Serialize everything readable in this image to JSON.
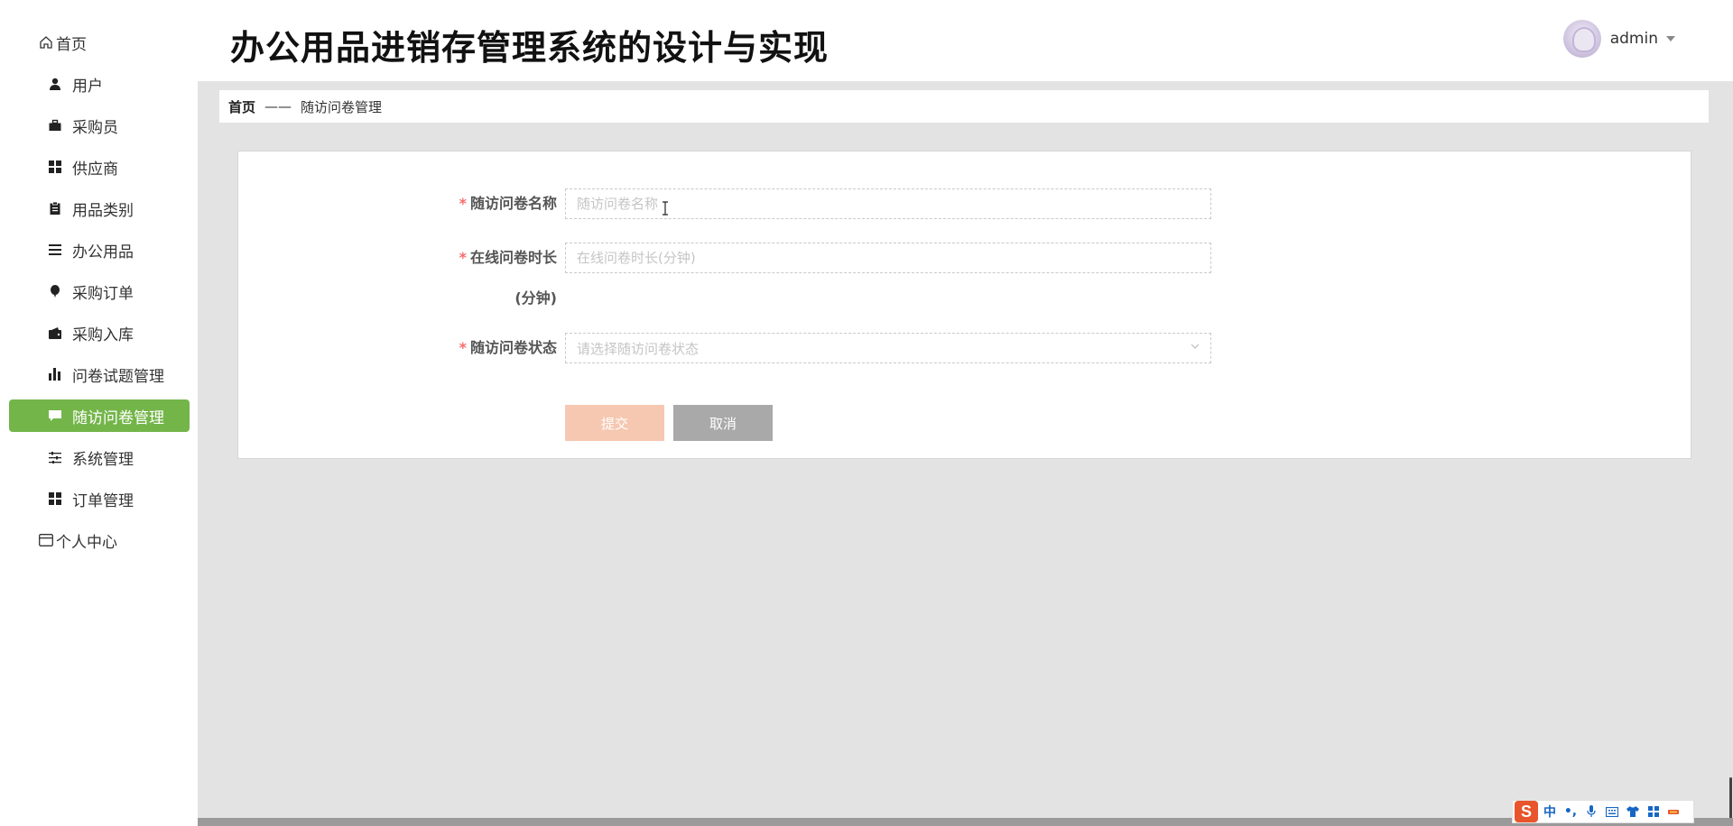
{
  "app": {
    "title": "办公用品进销存管理系统的设计与实现"
  },
  "user": {
    "name": "admin"
  },
  "sidebar": {
    "items": [
      {
        "label": "首页",
        "icon": "home-icon"
      },
      {
        "label": "用户",
        "icon": "user-icon"
      },
      {
        "label": "采购员",
        "icon": "briefcase-icon"
      },
      {
        "label": "供应商",
        "icon": "grid-icon"
      },
      {
        "label": "用品类别",
        "icon": "clipboard-icon"
      },
      {
        "label": "办公用品",
        "icon": "list-icon"
      },
      {
        "label": "采购订单",
        "icon": "balloon-icon"
      },
      {
        "label": "采购入库",
        "icon": "wallet-icon"
      },
      {
        "label": "问卷试题管理",
        "icon": "bar-chart-icon"
      },
      {
        "label": "随访问卷管理",
        "icon": "chat-icon",
        "active": true
      },
      {
        "label": "系统管理",
        "icon": "sliders-icon"
      },
      {
        "label": "订单管理",
        "icon": "grid-icon"
      },
      {
        "label": "个人中心",
        "icon": "card-icon"
      }
    ]
  },
  "breadcrumb": {
    "home": "首页",
    "separator": "——",
    "current": "随访问卷管理"
  },
  "form": {
    "name_label": "随访问卷名称",
    "name_placeholder": "随访问卷名称",
    "duration_label": "在线问卷时长",
    "duration_label_2": "(分钟)",
    "duration_placeholder": "在线问卷时长(分钟)",
    "status_label": "随访问卷状态",
    "status_placeholder": "请选择随访问卷状态",
    "required_mark": "*",
    "submit_label": "提交",
    "cancel_label": "取消"
  },
  "ime": {
    "logo": "S",
    "mode": "中",
    "punct": "•,",
    "icons": [
      "microphone-icon",
      "keyboard-icon",
      "shirt-icon",
      "apps-icon",
      "tools-icon"
    ]
  },
  "colors": {
    "active_menu": "#74b54a",
    "submit_button": "#f6c8b1",
    "cancel_button": "#a9a9a9",
    "required": "#f56c6c",
    "main_bg": "#e3e3e3"
  }
}
